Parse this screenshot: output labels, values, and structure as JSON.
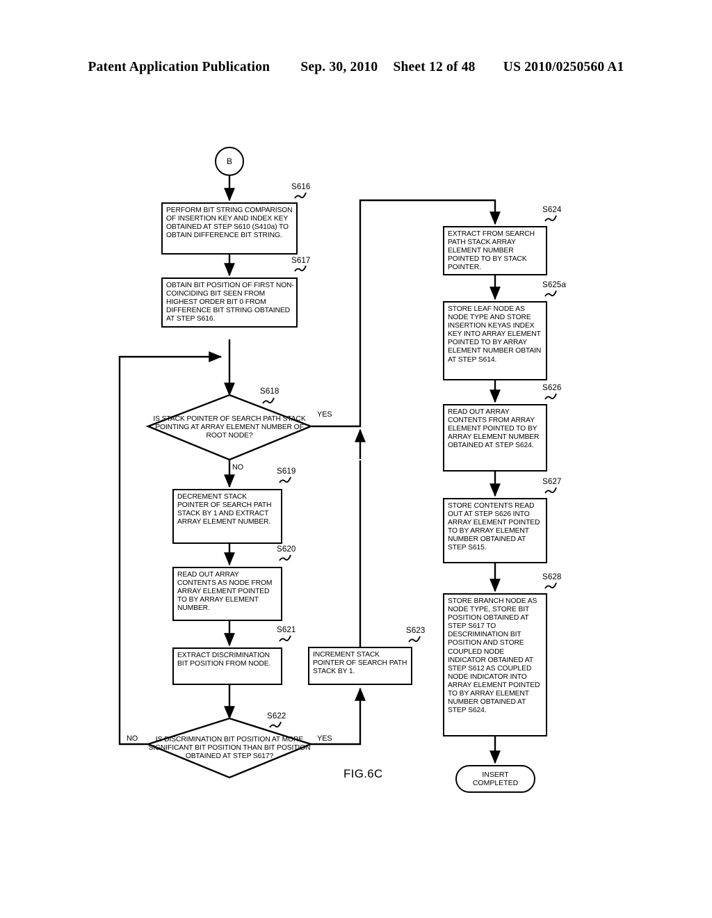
{
  "header": {
    "publication": "Patent Application Publication",
    "date": "Sep. 30, 2010",
    "sheet": "Sheet 12 of 48",
    "patent_number": "US 2010/0250560 A1"
  },
  "figure": {
    "caption": "FIG.6C"
  },
  "connector": {
    "label": "B"
  },
  "terminator": {
    "line1": "INSERT",
    "line2": "COMPLETED"
  },
  "branch_labels": {
    "s618_yes": "YES",
    "s618_no": "NO",
    "s622_yes": "YES",
    "s622_no": "NO"
  },
  "step_refs": {
    "s616": "S616",
    "s617": "S617",
    "s618": "S618",
    "s619": "S619",
    "s620": "S620",
    "s621": "S621",
    "s622": "S622",
    "s623": "S623",
    "s624": "S624",
    "s625a": "S625a",
    "s626": "S626",
    "s627": "S627",
    "s628": "S628"
  },
  "nodes": {
    "s616": {
      "id": "S616",
      "type": "process",
      "text": "PERFORM BIT STRING COMPARISON OF INSERTION KEY AND INDEX KEY OBTAINED AT STEP S610 (S410a) TO OBTAIN DIFFERENCE BIT STRING."
    },
    "s617": {
      "id": "S617",
      "type": "process",
      "text": "OBTAIN BIT POSITION OF FIRST NON-COINCIDING BIT SEEN FROM HIGHEST ORDER BIT 0 FROM DIFFERENCE BIT STRING OBTAINED AT STEP S616."
    },
    "s618": {
      "id": "S618",
      "type": "decision",
      "text": "IS STACK POINTER OF SEARCH PATH STACK POINTING AT ARRAY ELEMENT NUMBER OF ROOT NODE?"
    },
    "s619": {
      "id": "S619",
      "type": "process",
      "text": "DECREMENT STACK POINTER OF SEARCH PATH STACK BY 1 AND EXTRACT ARRAY ELEMENT NUMBER."
    },
    "s620": {
      "id": "S620",
      "type": "process",
      "text": "READ OUT ARRAY CONTENTS  AS NODE FROM ARRAY ELEMENT POINTED TO BY ARRAY ELEMENT NUMBER."
    },
    "s621": {
      "id": "S621",
      "type": "process",
      "text": "EXTRACT DISCRIMINATION BIT POSITION FROM NODE."
    },
    "s622": {
      "id": "S622",
      "type": "decision",
      "text": "IS DISCRIMINATION BIT POSITION AT MORE SIGNIFICANT BIT POSITION THAN BIT POSITION OBTAINED AT STEP S617?"
    },
    "s623": {
      "id": "S623",
      "type": "process",
      "text": "INCREMENT STACK POINTER OF SEARCH PATH STACK BY 1."
    },
    "s624": {
      "id": "S624",
      "type": "process",
      "text": "EXTRACT FROM SEARCH PATH STACK ARRAY ELEMENT NUMBER POINTED TO BY STACK POINTER."
    },
    "s625a": {
      "id": "S625a",
      "type": "process",
      "text": "STORE LEAF NODE AS NODE TYPE AND STORE INSERTION KEYAS INDEX KEY INTO ARRAY ELEMENT POINTED TO BY ARRAY ELEMENT NUMBER OBTAIN AT STEP S614."
    },
    "s626": {
      "id": "S626",
      "type": "process",
      "text": "READ OUT ARRAY CONTENTS FROM ARRAY ELEMENT POINTED TO BY ARRAY ELEMENT NUMBER OBTAINED AT STEP S624."
    },
    "s627": {
      "id": "S627",
      "type": "process",
      "text": "STORE CONTENTS READ OUT AT STEP S626 INTO ARRAY ELEMENT POINTED TO BY ARRAY ELEMENT NUMBER OBTAINED AT STEP S615."
    },
    "s628": {
      "id": "S628",
      "type": "process",
      "text": "STORE BRANCH NODE AS NODE TYPE,  STORE BIT POSITION OBTAINED AT STEP S617 TO DESCRIMINATION BIT POSITION AND STORE COUPLED NODE INDICATOR OBTAINED AT STEP S612 AS  COUPLED NODE INDICATOR INTO ARRAY ELEMENT POINTED TO BY  ARRAY ELEMENT NUMBER OBTAINED AT STEP S624."
    }
  }
}
